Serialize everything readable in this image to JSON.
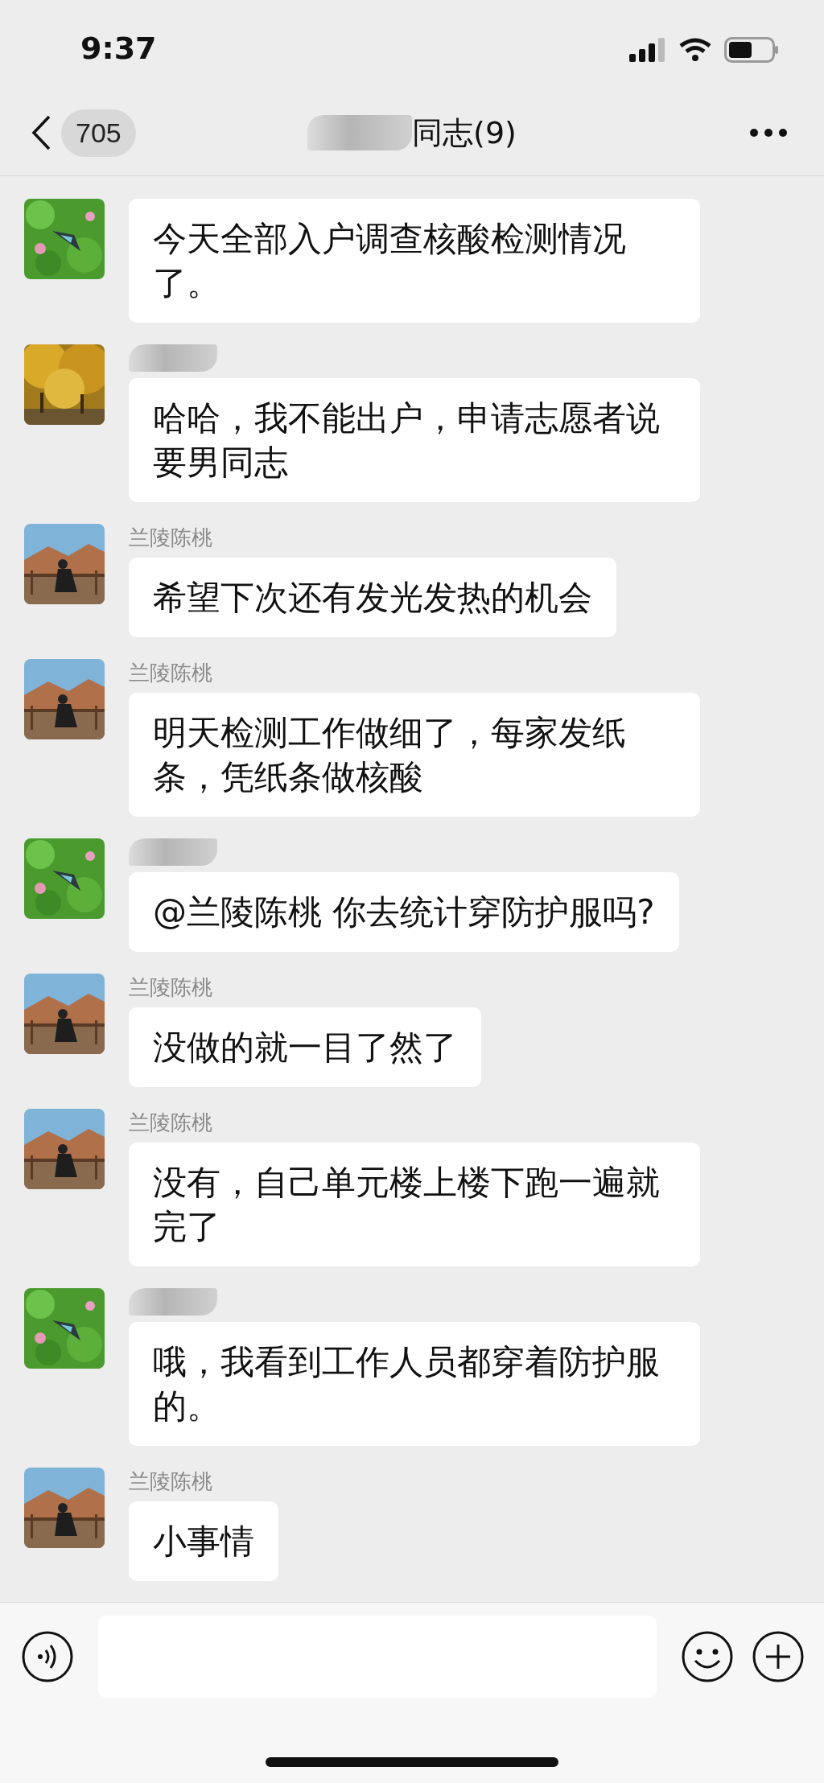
{
  "status_bar": {
    "time": "9:37"
  },
  "header": {
    "back_count": "705",
    "title": "同志(9)",
    "title_redacted": true
  },
  "messages": [
    {
      "sender_redacted": false,
      "text": "今天全部入户调查核酸检测情况了。"
    },
    {
      "sender_redacted": true,
      "text": "哈哈，我不能出户，申请志愿者说要男同志"
    },
    {
      "sender_redacted": false,
      "sender": "兰陵陈桃",
      "text": "希望下次还有发光发热的机会"
    },
    {
      "sender_redacted": false,
      "sender": "兰陵陈桃",
      "text": "明天检测工作做细了，每家发纸条，凭纸条做核酸"
    },
    {
      "sender_redacted": true,
      "text": "@兰陵陈桃 你去统计穿防护服吗?"
    },
    {
      "sender_redacted": false,
      "sender": "兰陵陈桃",
      "text": "没做的就一目了然了"
    },
    {
      "sender_redacted": false,
      "sender": "兰陵陈桃",
      "text": "没有，自己单元楼上楼下跑一遍就完了"
    },
    {
      "sender_redacted": true,
      "text": "哦，我看到工作人员都穿着防护服的。"
    },
    {
      "sender_redacted": false,
      "sender": "兰陵陈桃",
      "text": "小事情"
    }
  ]
}
